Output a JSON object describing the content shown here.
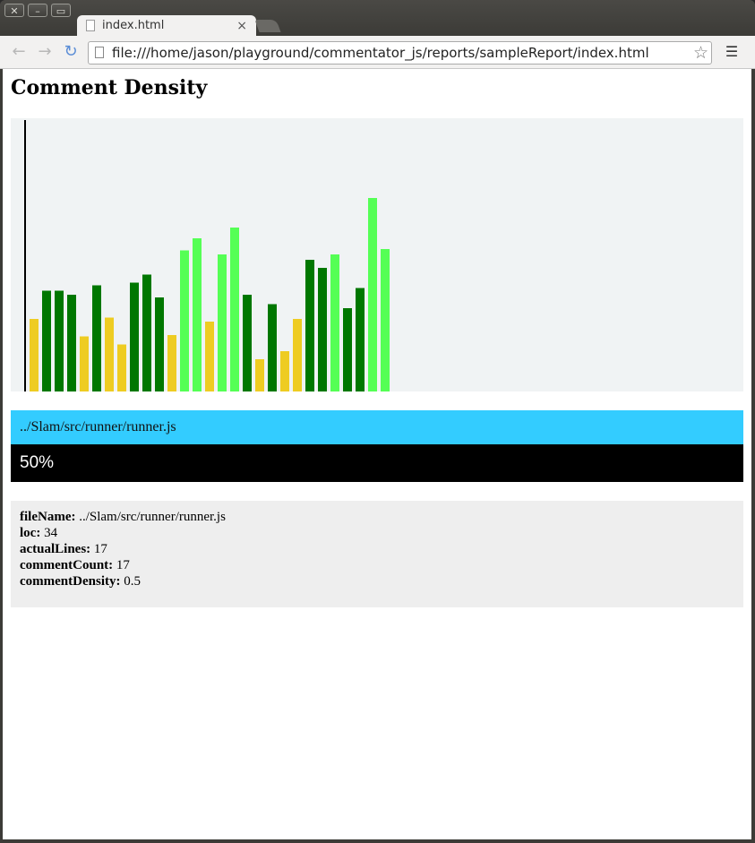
{
  "browser": {
    "tab_title": "index.html",
    "tab_close": "×",
    "url": "file:///home/jason/playground/commentator_js/reports/sampleReport/index.html"
  },
  "page": {
    "title": "Comment Density",
    "selected_file": "../Slam/src/runner/runner.js",
    "selected_percent": "50%",
    "details": [
      {
        "key": "fileName:",
        "value": " ../Slam/src/runner/runner.js"
      },
      {
        "key": "loc:",
        "value": " 34"
      },
      {
        "key": "actualLines:",
        "value": " 17"
      },
      {
        "key": "commentCount:",
        "value": " 17"
      },
      {
        "key": "commentDensity:",
        "value": " 0.5"
      }
    ]
  },
  "colors": {
    "low": "#eecc22",
    "mid": "#007700",
    "high": "#55ff55"
  },
  "chart_data": {
    "type": "bar",
    "ylim": [
      0,
      1
    ],
    "grid": false,
    "values": [
      0.27,
      0.375,
      0.375,
      0.36,
      0.205,
      0.395,
      0.275,
      0.175,
      0.405,
      0.435,
      0.35,
      0.21,
      0.525,
      0.57,
      0.26,
      0.51,
      0.61,
      0.36,
      0.12,
      0.325,
      0.15,
      0.27,
      0.49,
      0.46,
      0.51,
      0.31,
      0.385,
      0.72,
      0.53
    ],
    "bar_colors": [
      "low",
      "mid",
      "mid",
      "mid",
      "low",
      "mid",
      "low",
      "low",
      "mid",
      "mid",
      "mid",
      "low",
      "high",
      "high",
      "low",
      "high",
      "high",
      "mid",
      "low",
      "mid",
      "low",
      "low",
      "mid",
      "mid",
      "high",
      "mid",
      "mid",
      "high",
      "high"
    ]
  }
}
